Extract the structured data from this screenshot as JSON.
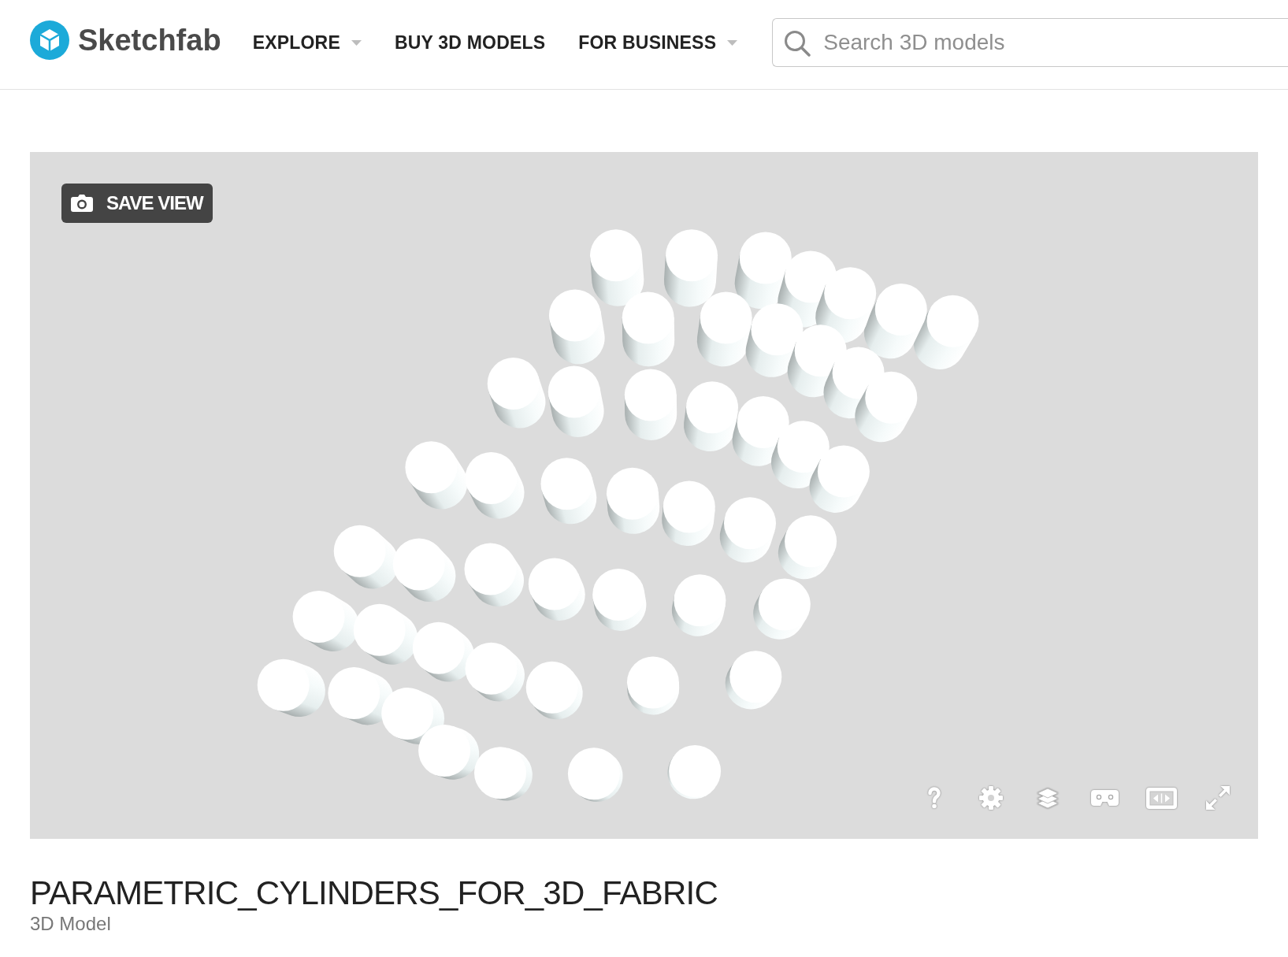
{
  "header": {
    "logo": {
      "text": "Sketchfab"
    },
    "nav": [
      {
        "label": "EXPLORE",
        "dropdown": true
      },
      {
        "label": "BUY 3D MODELS",
        "dropdown": false
      },
      {
        "label": "FOR BUSINESS",
        "dropdown": true
      }
    ],
    "search": {
      "placeholder": "Search 3D models"
    }
  },
  "viewer": {
    "save_view_button": "SAVE VIEW"
  },
  "model": {
    "title": "PARAMETRIC_CYLINDERS_FOR_3D_FABRIC",
    "subtitle": "3D Model"
  }
}
